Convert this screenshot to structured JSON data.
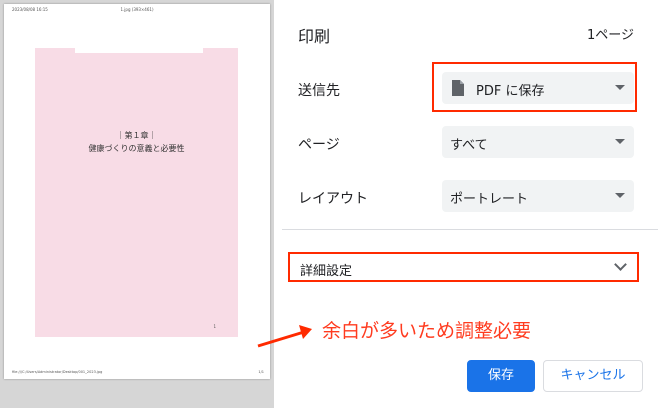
{
  "preview": {
    "header_left": "2023/08/08 16:15",
    "header_center": "1.jpg (393×461)",
    "chapter": "｜第１章｜",
    "chapter_title": "健康づくりの意義と必要性",
    "page_number": "1",
    "footer_left": "file:///C:/Users/Administrator/Desktop/001_2023.jpg",
    "footer_right": "1/1"
  },
  "panel": {
    "title": "印刷",
    "page_count": "1ページ",
    "destination": {
      "label": "送信先",
      "value": "PDF に保存"
    },
    "pages": {
      "label": "ページ",
      "value": "すべて"
    },
    "layout": {
      "label": "レイアウト",
      "value": "ポートレート"
    },
    "advanced": {
      "label": "詳細設定"
    }
  },
  "annotation": {
    "text": "余白が多いため調整必要",
    "color": "#ff3b1f"
  },
  "buttons": {
    "save": "保存",
    "cancel": "キャンセル"
  },
  "colors": {
    "accent": "#1a73e8",
    "highlight_box": "#ff2a00",
    "preview_fill": "#f8dce6"
  }
}
